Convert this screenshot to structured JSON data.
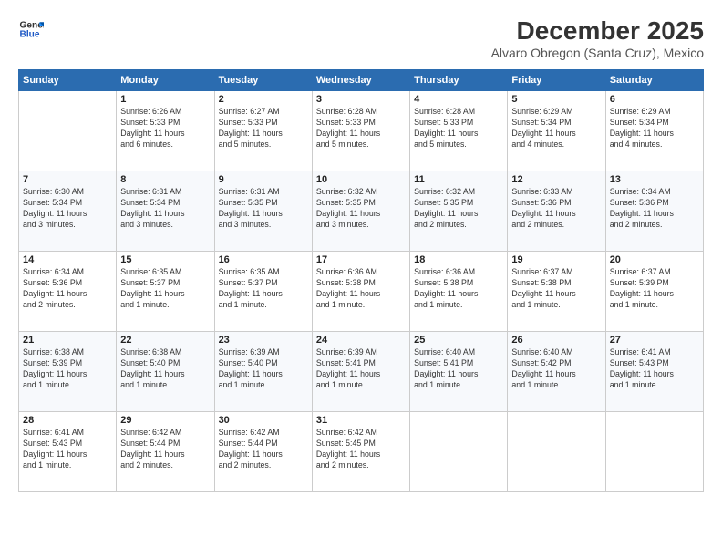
{
  "header": {
    "logo_line1": "General",
    "logo_line2": "Blue",
    "title": "December 2025",
    "subtitle": "Alvaro Obregon (Santa Cruz), Mexico"
  },
  "days_of_week": [
    "Sunday",
    "Monday",
    "Tuesday",
    "Wednesday",
    "Thursday",
    "Friday",
    "Saturday"
  ],
  "weeks": [
    [
      {
        "day": "",
        "lines": []
      },
      {
        "day": "1",
        "lines": [
          "Sunrise: 6:26 AM",
          "Sunset: 5:33 PM",
          "Daylight: 11 hours",
          "and 6 minutes."
        ]
      },
      {
        "day": "2",
        "lines": [
          "Sunrise: 6:27 AM",
          "Sunset: 5:33 PM",
          "Daylight: 11 hours",
          "and 5 minutes."
        ]
      },
      {
        "day": "3",
        "lines": [
          "Sunrise: 6:28 AM",
          "Sunset: 5:33 PM",
          "Daylight: 11 hours",
          "and 5 minutes."
        ]
      },
      {
        "day": "4",
        "lines": [
          "Sunrise: 6:28 AM",
          "Sunset: 5:33 PM",
          "Daylight: 11 hours",
          "and 5 minutes."
        ]
      },
      {
        "day": "5",
        "lines": [
          "Sunrise: 6:29 AM",
          "Sunset: 5:34 PM",
          "Daylight: 11 hours",
          "and 4 minutes."
        ]
      },
      {
        "day": "6",
        "lines": [
          "Sunrise: 6:29 AM",
          "Sunset: 5:34 PM",
          "Daylight: 11 hours",
          "and 4 minutes."
        ]
      }
    ],
    [
      {
        "day": "7",
        "lines": [
          "Sunrise: 6:30 AM",
          "Sunset: 5:34 PM",
          "Daylight: 11 hours",
          "and 3 minutes."
        ]
      },
      {
        "day": "8",
        "lines": [
          "Sunrise: 6:31 AM",
          "Sunset: 5:34 PM",
          "Daylight: 11 hours",
          "and 3 minutes."
        ]
      },
      {
        "day": "9",
        "lines": [
          "Sunrise: 6:31 AM",
          "Sunset: 5:35 PM",
          "Daylight: 11 hours",
          "and 3 minutes."
        ]
      },
      {
        "day": "10",
        "lines": [
          "Sunrise: 6:32 AM",
          "Sunset: 5:35 PM",
          "Daylight: 11 hours",
          "and 3 minutes."
        ]
      },
      {
        "day": "11",
        "lines": [
          "Sunrise: 6:32 AM",
          "Sunset: 5:35 PM",
          "Daylight: 11 hours",
          "and 2 minutes."
        ]
      },
      {
        "day": "12",
        "lines": [
          "Sunrise: 6:33 AM",
          "Sunset: 5:36 PM",
          "Daylight: 11 hours",
          "and 2 minutes."
        ]
      },
      {
        "day": "13",
        "lines": [
          "Sunrise: 6:34 AM",
          "Sunset: 5:36 PM",
          "Daylight: 11 hours",
          "and 2 minutes."
        ]
      }
    ],
    [
      {
        "day": "14",
        "lines": [
          "Sunrise: 6:34 AM",
          "Sunset: 5:36 PM",
          "Daylight: 11 hours",
          "and 2 minutes."
        ]
      },
      {
        "day": "15",
        "lines": [
          "Sunrise: 6:35 AM",
          "Sunset: 5:37 PM",
          "Daylight: 11 hours",
          "and 1 minute."
        ]
      },
      {
        "day": "16",
        "lines": [
          "Sunrise: 6:35 AM",
          "Sunset: 5:37 PM",
          "Daylight: 11 hours",
          "and 1 minute."
        ]
      },
      {
        "day": "17",
        "lines": [
          "Sunrise: 6:36 AM",
          "Sunset: 5:38 PM",
          "Daylight: 11 hours",
          "and 1 minute."
        ]
      },
      {
        "day": "18",
        "lines": [
          "Sunrise: 6:36 AM",
          "Sunset: 5:38 PM",
          "Daylight: 11 hours",
          "and 1 minute."
        ]
      },
      {
        "day": "19",
        "lines": [
          "Sunrise: 6:37 AM",
          "Sunset: 5:38 PM",
          "Daylight: 11 hours",
          "and 1 minute."
        ]
      },
      {
        "day": "20",
        "lines": [
          "Sunrise: 6:37 AM",
          "Sunset: 5:39 PM",
          "Daylight: 11 hours",
          "and 1 minute."
        ]
      }
    ],
    [
      {
        "day": "21",
        "lines": [
          "Sunrise: 6:38 AM",
          "Sunset: 5:39 PM",
          "Daylight: 11 hours",
          "and 1 minute."
        ]
      },
      {
        "day": "22",
        "lines": [
          "Sunrise: 6:38 AM",
          "Sunset: 5:40 PM",
          "Daylight: 11 hours",
          "and 1 minute."
        ]
      },
      {
        "day": "23",
        "lines": [
          "Sunrise: 6:39 AM",
          "Sunset: 5:40 PM",
          "Daylight: 11 hours",
          "and 1 minute."
        ]
      },
      {
        "day": "24",
        "lines": [
          "Sunrise: 6:39 AM",
          "Sunset: 5:41 PM",
          "Daylight: 11 hours",
          "and 1 minute."
        ]
      },
      {
        "day": "25",
        "lines": [
          "Sunrise: 6:40 AM",
          "Sunset: 5:41 PM",
          "Daylight: 11 hours",
          "and 1 minute."
        ]
      },
      {
        "day": "26",
        "lines": [
          "Sunrise: 6:40 AM",
          "Sunset: 5:42 PM",
          "Daylight: 11 hours",
          "and 1 minute."
        ]
      },
      {
        "day": "27",
        "lines": [
          "Sunrise: 6:41 AM",
          "Sunset: 5:43 PM",
          "Daylight: 11 hours",
          "and 1 minute."
        ]
      }
    ],
    [
      {
        "day": "28",
        "lines": [
          "Sunrise: 6:41 AM",
          "Sunset: 5:43 PM",
          "Daylight: 11 hours",
          "and 1 minute."
        ]
      },
      {
        "day": "29",
        "lines": [
          "Sunrise: 6:42 AM",
          "Sunset: 5:44 PM",
          "Daylight: 11 hours",
          "and 2 minutes."
        ]
      },
      {
        "day": "30",
        "lines": [
          "Sunrise: 6:42 AM",
          "Sunset: 5:44 PM",
          "Daylight: 11 hours",
          "and 2 minutes."
        ]
      },
      {
        "day": "31",
        "lines": [
          "Sunrise: 6:42 AM",
          "Sunset: 5:45 PM",
          "Daylight: 11 hours",
          "and 2 minutes."
        ]
      },
      {
        "day": "",
        "lines": []
      },
      {
        "day": "",
        "lines": []
      },
      {
        "day": "",
        "lines": []
      }
    ]
  ]
}
